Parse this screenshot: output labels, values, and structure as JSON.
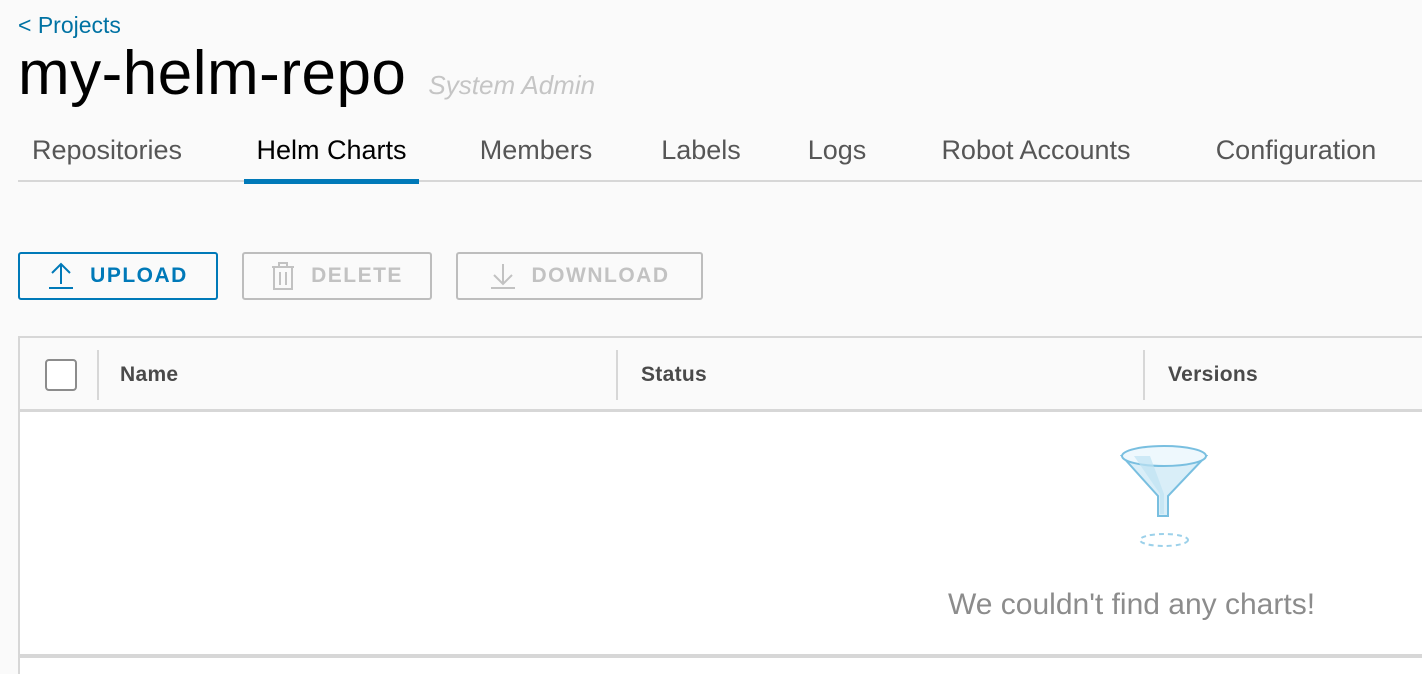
{
  "breadcrumb": {
    "label": "< Projects"
  },
  "header": {
    "title": "my-helm-repo",
    "role": "System Admin"
  },
  "tabs": [
    {
      "label": "Repositories",
      "active": false
    },
    {
      "label": "Helm Charts",
      "active": true
    },
    {
      "label": "Members",
      "active": false
    },
    {
      "label": "Labels",
      "active": false
    },
    {
      "label": "Logs",
      "active": false
    },
    {
      "label": "Robot Accounts",
      "active": false
    },
    {
      "label": "Configuration",
      "active": false
    }
  ],
  "toolbar": {
    "upload": {
      "label": "UPLOAD",
      "icon": "upload-icon",
      "enabled": true
    },
    "delete": {
      "label": "DELETE",
      "icon": "trash-icon",
      "enabled": false
    },
    "download": {
      "label": "DOWNLOAD",
      "icon": "download-icon",
      "enabled": false
    }
  },
  "table": {
    "columns": [
      "Name",
      "Status",
      "Versions"
    ],
    "rows": [],
    "empty_message": "We couldn't find any charts!",
    "empty_icon": "funnel-icon"
  },
  "colors": {
    "accent": "#0079b8",
    "link": "#0072a3",
    "disabled": "#c2c2c2",
    "background": "#fafafa"
  }
}
